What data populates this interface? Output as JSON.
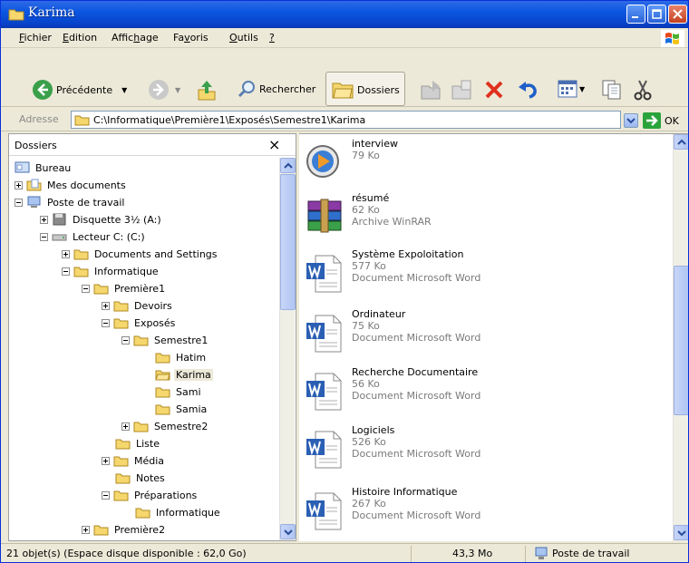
{
  "window": {
    "title": "Karima"
  },
  "menu": {
    "items": [
      {
        "pre": "",
        "key": "F",
        "post": "ichier"
      },
      {
        "pre": "",
        "key": "E",
        "post": "dition"
      },
      {
        "pre": "Affic",
        "key": "h",
        "post": "age"
      },
      {
        "pre": "Fa",
        "key": "v",
        "post": "oris"
      },
      {
        "pre": "",
        "key": "O",
        "post": "utils"
      },
      {
        "pre": "",
        "key": "?",
        "post": ""
      }
    ]
  },
  "toolbar": {
    "back_label": "Précédente",
    "search_label": "Rechercher",
    "folders_label": "Dossiers"
  },
  "address": {
    "label": "Adresse",
    "value": "C:\\Informatique\\Première1\\Exposés\\Semestre1\\Karima",
    "go_label": "OK"
  },
  "folders_pane": {
    "title": "Dossiers",
    "close": "×",
    "tree": [
      {
        "label": "Bureau",
        "icon": "desktop-icon",
        "expander": "none"
      },
      {
        "label": "Mes documents",
        "icon": "my-documents-icon",
        "expander": "plus"
      },
      {
        "label": "Poste de travail",
        "icon": "my-computer-icon",
        "expander": "minus"
      },
      {
        "label": "Disquette 3½ (A:)",
        "icon": "floppy-icon",
        "expander": "plus"
      },
      {
        "label": "Lecteur C: (C:)",
        "icon": "drive-icon",
        "expander": "minus"
      },
      {
        "label": "Documents and Settings",
        "icon": "folder-icon",
        "expander": "plus"
      },
      {
        "label": "Informatique",
        "icon": "folder-icon",
        "expander": "minus"
      },
      {
        "label": "Première1",
        "icon": "folder-icon",
        "expander": "minus"
      },
      {
        "label": "Devoirs",
        "icon": "folder-icon",
        "expander": "plus"
      },
      {
        "label": "Exposés",
        "icon": "folder-icon",
        "expander": "minus"
      },
      {
        "label": "Semestre1",
        "icon": "folder-icon",
        "expander": "minus"
      },
      {
        "label": "Hatim",
        "icon": "folder-icon",
        "expander": "none"
      },
      {
        "label": "Karima",
        "icon": "folder-open-icon",
        "expander": "none"
      },
      {
        "label": "Sami",
        "icon": "folder-icon",
        "expander": "none"
      },
      {
        "label": "Samia",
        "icon": "folder-icon",
        "expander": "none"
      },
      {
        "label": "Semestre2",
        "icon": "folder-icon",
        "expander": "plus"
      },
      {
        "label": "Liste",
        "icon": "folder-icon",
        "expander": "none"
      },
      {
        "label": "Média",
        "icon": "folder-icon",
        "expander": "plus"
      },
      {
        "label": "Notes",
        "icon": "folder-icon",
        "expander": "none"
      },
      {
        "label": "Préparations",
        "icon": "folder-icon",
        "expander": "minus"
      },
      {
        "label": "Informatique",
        "icon": "folder-icon",
        "expander": "none"
      },
      {
        "label": "Première2",
        "icon": "folder-icon",
        "expander": "plus"
      }
    ]
  },
  "files": [
    {
      "name": "interview",
      "size": "79 Ko",
      "type": "",
      "icon": "media-player-icon"
    },
    {
      "name": "résumé",
      "size": "62 Ko",
      "type": "Archive WinRAR",
      "icon": "winrar-archive-icon"
    },
    {
      "name": "Système Expoloitation",
      "size": "577 Ko",
      "type": "Document Microsoft Word",
      "icon": "word-document-icon"
    },
    {
      "name": "Ordinateur",
      "size": "75 Ko",
      "type": "Document Microsoft Word",
      "icon": "word-document-icon"
    },
    {
      "name": "Recherche Documentaire",
      "size": "56 Ko",
      "type": "Document Microsoft Word",
      "icon": "word-document-icon"
    },
    {
      "name": "Logiciels",
      "size": "526 Ko",
      "type": "Document Microsoft Word",
      "icon": "word-document-icon"
    },
    {
      "name": "Histoire Informatique",
      "size": "267 Ko",
      "type": "Document Microsoft Word",
      "icon": "word-document-icon"
    }
  ],
  "status": {
    "objects": "21 objet(s) (Espace disque disponible : 62,0 Go)",
    "size": "43,3 Mo",
    "location": "Poste de travail"
  },
  "colors": {
    "titlebar": "#0a56e1",
    "folder": "#f5d76e",
    "word_blue": "#2b5fb4"
  }
}
